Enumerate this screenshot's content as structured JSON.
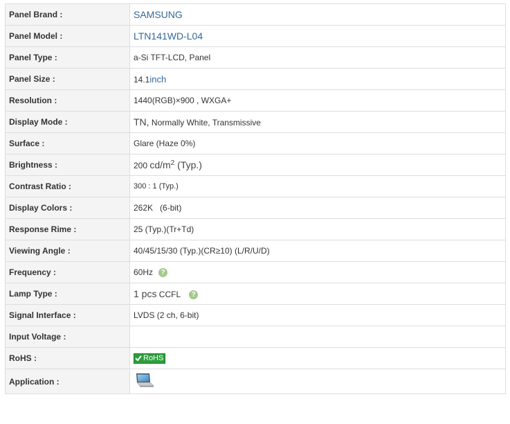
{
  "rows": [
    {
      "label": "Panel Brand :",
      "value": "SAMSUNG"
    },
    {
      "label": "Panel Model :",
      "value": "LTN141WD-L04"
    },
    {
      "label": "Panel Type :",
      "value": "a-Si TFT-LCD, Panel"
    },
    {
      "label": "Panel Size :",
      "value": "14.1",
      "unit": "inch"
    },
    {
      "label": "Resolution :",
      "value": "1440(RGB)×900 , WXGA+"
    },
    {
      "label": "Display Mode :",
      "value_a": "TN,",
      "value_b": " Normally White, Transmissive"
    },
    {
      "label": "Surface :",
      "value": "Glare (Haze 0%)"
    },
    {
      "label": "Brightness :",
      "value": "200",
      "unit": "cd/m",
      "sup": "2",
      "suffix": " (Typ.)"
    },
    {
      "label": "Contrast Ratio :",
      "value": "300 : 1 (Typ.)"
    },
    {
      "label": "Display Colors :",
      "value": "262K   (6-bit)"
    },
    {
      "label": "Response Rime :",
      "value": "25 (Typ.)(Tr+Td)"
    },
    {
      "label": "Viewing Angle :",
      "value": "40/45/15/30 (Typ.)(CR≥10) (L/R/U/D)"
    },
    {
      "label": "Frequency :",
      "value": "60Hz",
      "help_icon": "question-icon"
    },
    {
      "label": "Lamp Type :",
      "value_a": "1 pcs",
      "value_b": " CCFL",
      "help_icon": "question-icon"
    },
    {
      "label": "Signal Interface :",
      "value": "LVDS (2 ch, 6-bit)"
    },
    {
      "label": "Input Voltage :",
      "value": ""
    },
    {
      "label": "RoHS :",
      "badge": "RoHS",
      "badge_icon": "checkmark-icon",
      "badge_color": "#2e9e3c"
    },
    {
      "label": "Application :",
      "icon": "laptop-icon"
    }
  ],
  "colors": {
    "label_bg": "#f4f4f4",
    "border": "#dddddd",
    "link": "#33679c",
    "help": "#a4c98c"
  }
}
